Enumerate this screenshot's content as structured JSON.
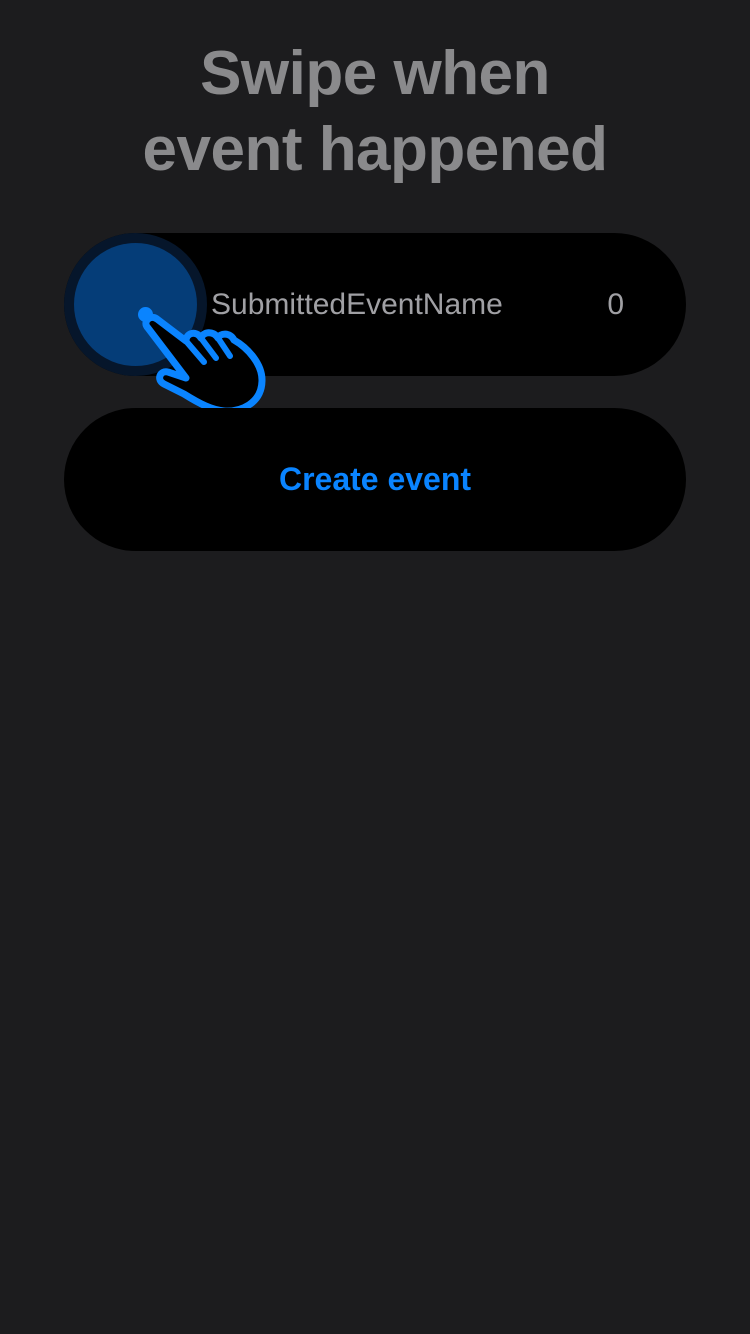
{
  "header": {
    "title_line1": "Swipe when",
    "title_line2": "event happened"
  },
  "event_row": {
    "name": "SubmittedEventName",
    "count": "0"
  },
  "create_button": {
    "label": "Create event"
  },
  "hint": {
    "icon": "tap-hand-icon"
  },
  "colors": {
    "background": "#1c1c1e",
    "row_background": "#000000",
    "accent": "#0a84ff",
    "knob": "#053d78",
    "title_text": "#8a8a8c",
    "row_text": "#a0a0a4"
  }
}
